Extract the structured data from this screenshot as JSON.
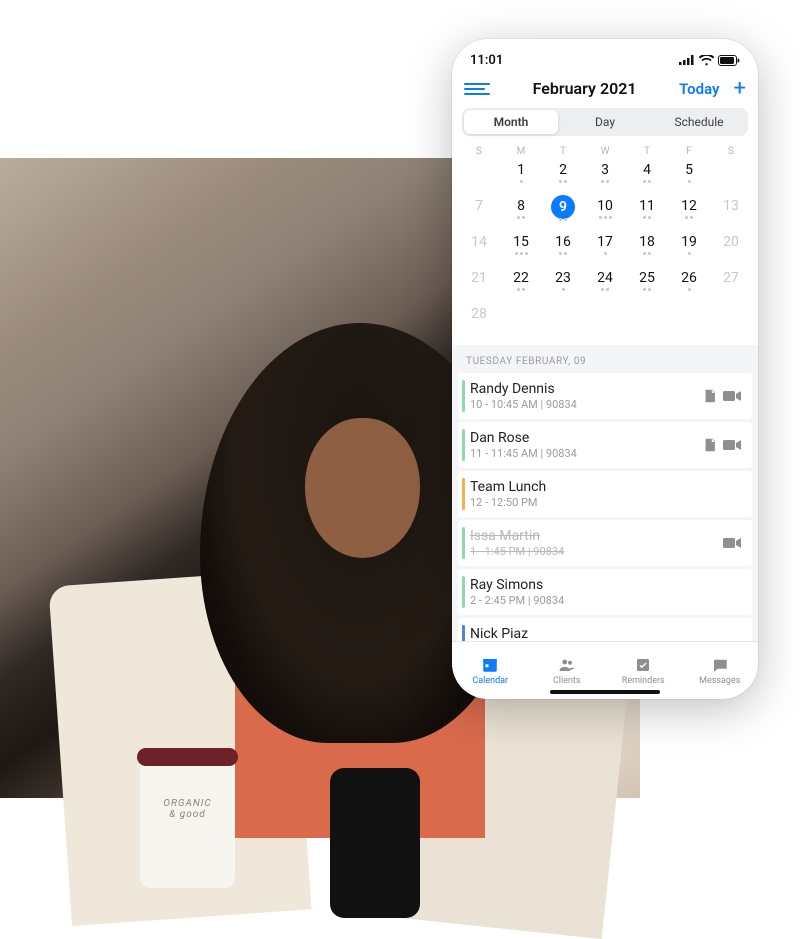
{
  "statusbar": {
    "time": "11:01"
  },
  "header": {
    "title": "February 2021",
    "today_label": "Today"
  },
  "segments": {
    "month": "Month",
    "day": "Day",
    "schedule": "Schedule"
  },
  "weekdays": [
    "S",
    "M",
    "T",
    "W",
    "T",
    "F",
    "S"
  ],
  "calendar": {
    "selected": 9,
    "rows": [
      [
        {
          "n": "",
          "dim": true
        },
        {
          "n": "1",
          "dots": 1
        },
        {
          "n": "2",
          "dots": 2
        },
        {
          "n": "3",
          "dots": 2
        },
        {
          "n": "4",
          "dots": 2
        },
        {
          "n": "5",
          "dots": 1
        },
        {
          "n": "",
          "dim": true
        }
      ],
      [
        {
          "n": "7",
          "dim": true
        },
        {
          "n": "8",
          "dots": 2
        },
        {
          "n": "9",
          "dots": 2,
          "sel": true
        },
        {
          "n": "10",
          "dots": 3
        },
        {
          "n": "11",
          "dots": 2
        },
        {
          "n": "12",
          "dots": 2
        },
        {
          "n": "13",
          "dim": true
        }
      ],
      [
        {
          "n": "14",
          "dim": true
        },
        {
          "n": "15",
          "dots": 3
        },
        {
          "n": "16",
          "dots": 2
        },
        {
          "n": "17",
          "dots": 1
        },
        {
          "n": "18",
          "dots": 2
        },
        {
          "n": "19",
          "dots": 1
        },
        {
          "n": "20",
          "dim": true
        }
      ],
      [
        {
          "n": "21",
          "dim": true
        },
        {
          "n": "22",
          "dots": 2
        },
        {
          "n": "23",
          "dots": 1
        },
        {
          "n": "24",
          "dots": 2
        },
        {
          "n": "25",
          "dots": 2
        },
        {
          "n": "26",
          "dots": 1
        },
        {
          "n": "27",
          "dim": true
        }
      ],
      [
        {
          "n": "28",
          "dim": true
        },
        {
          "n": ""
        },
        {
          "n": ""
        },
        {
          "n": ""
        },
        {
          "n": ""
        },
        {
          "n": ""
        },
        {
          "n": ""
        }
      ]
    ]
  },
  "list": {
    "section_label": "TUESDAY FEBRUARY, 09",
    "items": [
      {
        "name": "Randy Dennis",
        "sub": "10 - 10:45 AM  |  90834",
        "color": "green",
        "note": true,
        "video": true
      },
      {
        "name": "Dan Rose",
        "sub": "11 - 11:45 AM  |  90834",
        "color": "green",
        "note": true,
        "video": true
      },
      {
        "name": "Team Lunch",
        "sub": "12 - 12:50 PM",
        "color": "orange"
      },
      {
        "name": "Issa Martin",
        "sub": "1 - 1:45 PM  |  90834",
        "color": "green",
        "cancelled": true,
        "video": true
      },
      {
        "name": "Ray Simons",
        "sub": "2 - 2:45 PM  |  90834",
        "color": "green"
      },
      {
        "name": "Nick Piaz",
        "sub": "",
        "color": "blue"
      }
    ]
  },
  "tabs": {
    "calendar": "Calendar",
    "clients": "Clients",
    "reminders": "Reminders",
    "messages": "Messages"
  }
}
